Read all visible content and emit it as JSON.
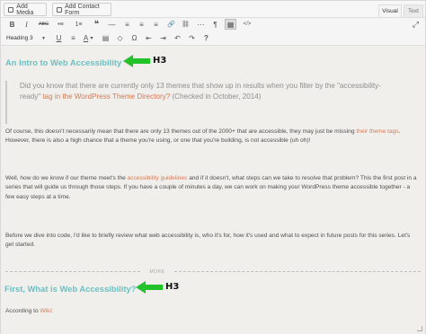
{
  "media_buttons": {
    "add_media": "Add Media",
    "add_contact_form": "Add Contact Form"
  },
  "tabs": {
    "visual": "Visual",
    "text": "Text"
  },
  "toolbar": {
    "row1": [
      {
        "glyph": "B",
        "icon": "bold-icon"
      },
      {
        "glyph": "I",
        "icon": "italic-icon"
      },
      {
        "glyph": "ABC",
        "icon": "strikethrough-icon"
      },
      {
        "glyph": "•≡",
        "icon": "bulleted-list-icon"
      },
      {
        "glyph": "1≡",
        "icon": "numbered-list-icon"
      },
      {
        "glyph": "❝",
        "icon": "blockquote-icon"
      },
      {
        "glyph": "—",
        "icon": "horizontal-line-icon"
      },
      {
        "glyph": "≡",
        "icon": "align-left-icon"
      },
      {
        "glyph": "≡",
        "icon": "align-center-icon"
      },
      {
        "glyph": "≡",
        "icon": "align-right-icon"
      },
      {
        "glyph": "🔗",
        "icon": "insert-link-icon"
      },
      {
        "glyph": "⛓",
        "icon": "unlink-icon"
      },
      {
        "glyph": "⋯",
        "icon": "read-more-icon"
      },
      {
        "glyph": "¶",
        "icon": "paragraph-icon"
      },
      {
        "glyph": "▦",
        "icon": "toolbar-toggle-icon"
      },
      {
        "glyph": "</>",
        "icon": "code-icon"
      }
    ],
    "format_select": "Heading 3",
    "row2": [
      {
        "glyph": "U",
        "icon": "underline-icon"
      },
      {
        "glyph": "≡",
        "icon": "justify-icon"
      },
      {
        "glyph": "A",
        "icon": "text-color-icon"
      },
      {
        "glyph": "▾",
        "icon": "text-color-dropdown-icon"
      },
      {
        "glyph": "▤",
        "icon": "paste-as-text-icon"
      },
      {
        "glyph": "◇",
        "icon": "clear-formatting-icon"
      },
      {
        "glyph": "Ω",
        "icon": "special-character-icon"
      },
      {
        "glyph": "⇤",
        "icon": "outdent-icon"
      },
      {
        "glyph": "⇥",
        "icon": "indent-icon"
      },
      {
        "glyph": "↶",
        "icon": "undo-icon"
      },
      {
        "glyph": "↷",
        "icon": "redo-icon"
      },
      {
        "glyph": "?",
        "icon": "help-icon"
      }
    ],
    "fullscreen_glyph": "⤢"
  },
  "content": {
    "heading_intro": "An Intro to Web Accessibility",
    "heading_first": "First, What is Web Accessibility?",
    "arrow_label": "H3",
    "quote": {
      "before": "Did you know that there are currently only 13 themes that show up in results when you filter by the \"accessibility-ready\" ",
      "link": "tag in the WordPress Theme Directory?",
      "after": " (Checked in October, 2014)"
    },
    "p1": {
      "before": "Of course, this doesn't necessarily mean that there are only 13 themes out of the 2000+ that are accessible, they may just be missing ",
      "link": "their theme tags",
      "after": ". However, there is also a high chance that a theme you're using, or one that you're building, is not accessible (uh oh)!"
    },
    "p2": {
      "before": "Well, how do we know if our theme meet's the ",
      "link": "accessibility guidelines",
      "after": " and if it doesn't, what steps can we take to resolve that problem? This the first post in a series that will guide us through those steps. If you have a couple of minutes a day, we can work on making your WordPress theme accessible together - a few easy steps at a time."
    },
    "p3": "Before we dive into code, I'd like to briefly review what web accessibility is, who it's for, how it's used and what to expect in future posts for this series. Let's get started.",
    "more_label": "MORE",
    "p4": {
      "before": "According to ",
      "link": "Wiki",
      "after": ":"
    }
  },
  "colors": {
    "heading": "#6cc0c2",
    "link": "#d87a55",
    "arrow": "#22c32a",
    "background": "#f1efeb"
  }
}
